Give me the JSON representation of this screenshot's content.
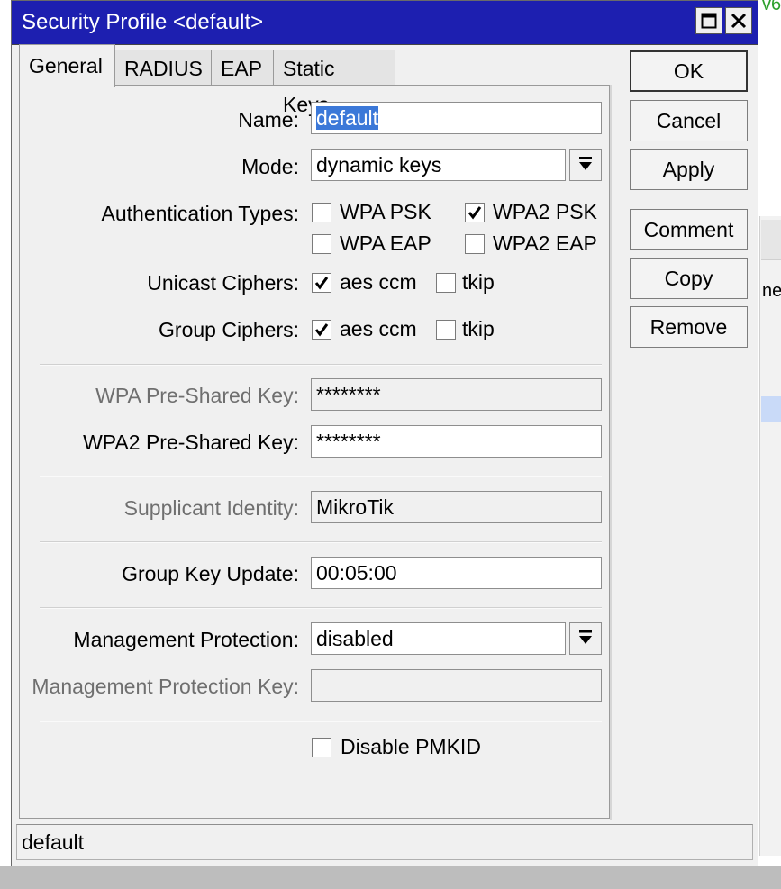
{
  "window": {
    "title": "Security Profile <default>"
  },
  "tabs": [
    {
      "label": "General",
      "active": true
    },
    {
      "label": "RADIUS",
      "active": false
    },
    {
      "label": "EAP",
      "active": false
    },
    {
      "label": "Static Keys",
      "active": false
    }
  ],
  "form": {
    "name": {
      "label": "Name:",
      "value": "default"
    },
    "mode": {
      "label": "Mode:",
      "value": "dynamic keys"
    },
    "auth_types": {
      "label": "Authentication Types:",
      "options": [
        {
          "label": "WPA PSK",
          "checked": false
        },
        {
          "label": "WPA2 PSK",
          "checked": true
        },
        {
          "label": "WPA EAP",
          "checked": false
        },
        {
          "label": "WPA2 EAP",
          "checked": false
        }
      ]
    },
    "unicast_ciphers": {
      "label": "Unicast Ciphers:",
      "options": [
        {
          "label": "aes ccm",
          "checked": true
        },
        {
          "label": "tkip",
          "checked": false
        }
      ]
    },
    "group_ciphers": {
      "label": "Group Ciphers:",
      "options": [
        {
          "label": "aes ccm",
          "checked": true
        },
        {
          "label": "tkip",
          "checked": false
        }
      ]
    },
    "wpa_psk": {
      "label": "WPA Pre-Shared Key:",
      "value": "********"
    },
    "wpa2_psk": {
      "label": "WPA2 Pre-Shared Key:",
      "value": "********"
    },
    "supplicant_identity": {
      "label": "Supplicant Identity:",
      "value": "MikroTik"
    },
    "group_key_update": {
      "label": "Group Key Update:",
      "value": "00:05:00"
    },
    "management_protection": {
      "label": "Management Protection:",
      "value": "disabled"
    },
    "management_protection_key": {
      "label": "Management Protection Key:",
      "value": ""
    },
    "disable_pmkid": {
      "label": "Disable PMKID",
      "checked": false
    }
  },
  "buttons": {
    "ok": "OK",
    "cancel": "Cancel",
    "apply": "Apply",
    "comment": "Comment",
    "copy": "Copy",
    "remove": "Remove"
  },
  "status_bar": "default",
  "background": {
    "fragment_top": "v6",
    "fragment_mid": "ne"
  },
  "colors": {
    "titlebar": "#1d1fb0",
    "selection": "#3b78d8"
  }
}
